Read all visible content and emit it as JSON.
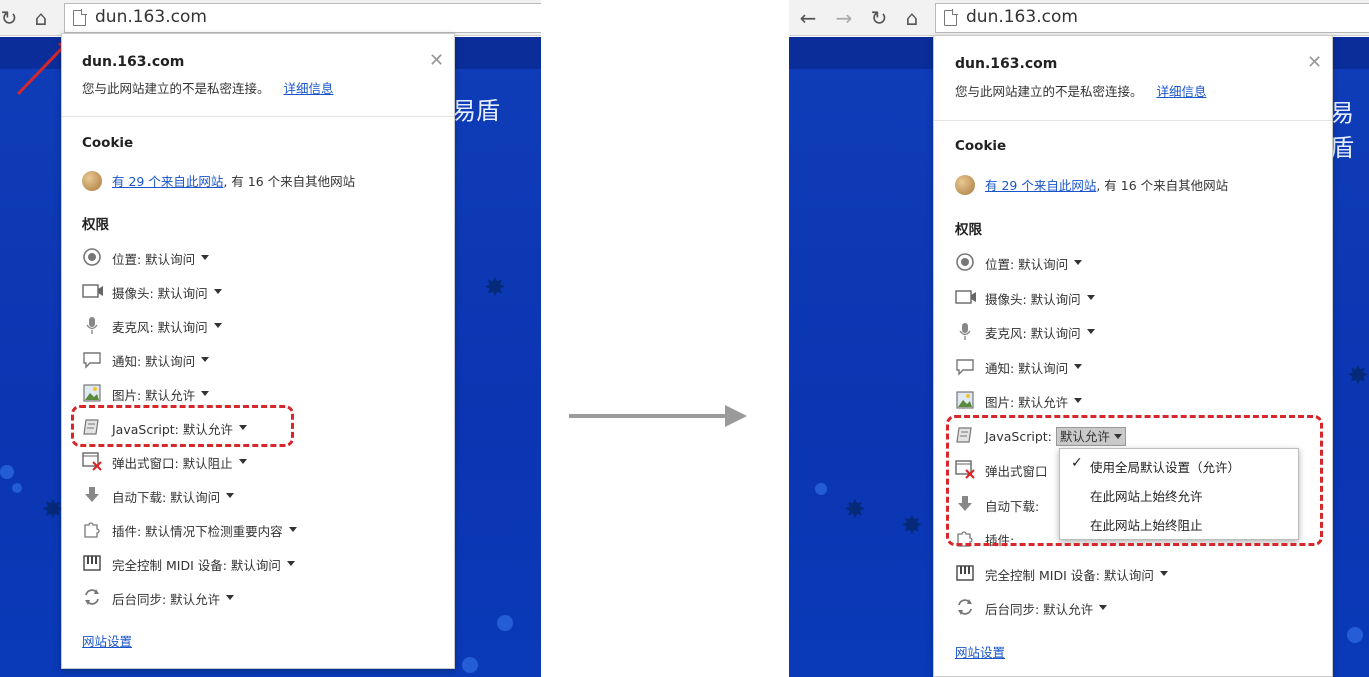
{
  "left": {
    "url": "dun.163.com",
    "popup": {
      "host": "dun.163.com",
      "connection_msg": "您与此网站建立的不是私密连接。",
      "details_link": "详细信息",
      "cookie_heading": "Cookie",
      "cookie_link": "有 29 个来自此网站",
      "cookie_rest": ", 有 16 个来自其他网站",
      "perm_heading": "权限",
      "perms": [
        {
          "icon": "location-icon",
          "text": "位置: 默认询问"
        },
        {
          "icon": "camera-icon",
          "text": "摄像头: 默认询问"
        },
        {
          "icon": "microphone-icon",
          "text": "麦克风: 默认询问"
        },
        {
          "icon": "notification-icon",
          "text": "通知: 默认询问"
        },
        {
          "icon": "image-icon",
          "text": "图片: 默认允许"
        },
        {
          "icon": "javascript-icon",
          "text": "JavaScript: 默认允许"
        },
        {
          "icon": "popup-blocked-icon",
          "text": "弹出式窗口: 默认阻止"
        },
        {
          "icon": "download-icon",
          "text": "自动下载: 默认询问"
        },
        {
          "icon": "plugin-icon",
          "text": "插件: 默认情况下检测重要内容"
        },
        {
          "icon": "midi-icon",
          "text": "完全控制 MIDI 设备: 默认询问"
        },
        {
          "icon": "sync-icon",
          "text": "后台同步: 默认允许"
        }
      ],
      "site_settings": "网站设置"
    },
    "brand_char": "易盾"
  },
  "right": {
    "url": "dun.163.com",
    "popup": {
      "host": "dun.163.com",
      "connection_msg": "您与此网站建立的不是私密连接。",
      "details_link": "详细信息",
      "cookie_heading": "Cookie",
      "cookie_link": "有 29 个来自此网站",
      "cookie_rest": ", 有 16 个来自其他网站",
      "perm_heading": "权限",
      "perms": [
        {
          "icon": "location-icon",
          "text": "位置: 默认询问"
        },
        {
          "icon": "camera-icon",
          "text": "摄像头: 默认询问"
        },
        {
          "icon": "microphone-icon",
          "text": "麦克风: 默认询问"
        },
        {
          "icon": "notification-icon",
          "text": "通知: 默认询问"
        },
        {
          "icon": "image-icon",
          "text": "图片: 默认允许"
        },
        {
          "icon": "javascript-icon",
          "text": "JavaScript:"
        },
        {
          "icon": "popup-blocked-icon",
          "text": "弹出式窗口"
        },
        {
          "icon": "download-icon",
          "text": "自动下载:"
        },
        {
          "icon": "plugin-icon",
          "text": "插件:"
        },
        {
          "icon": "midi-icon",
          "text": "完全控制 MIDI 设备: 默认询问"
        },
        {
          "icon": "sync-icon",
          "text": "后台同步: 默认允许"
        }
      ],
      "js_dropdown_value": "默认允许",
      "site_settings": "网站设置"
    },
    "menu": [
      {
        "label": "使用全局默认设置（允许）",
        "checked": true
      },
      {
        "label": "在此网站上始终允许",
        "checked": false
      },
      {
        "label": "在此网站上始终阻止",
        "checked": false
      }
    ],
    "brand_char": "易盾"
  },
  "colors": {
    "highlight": "#d6272b",
    "link": "#1a55c9",
    "site_blue": "#0b35b2",
    "arrow": "#9a9a9a"
  }
}
